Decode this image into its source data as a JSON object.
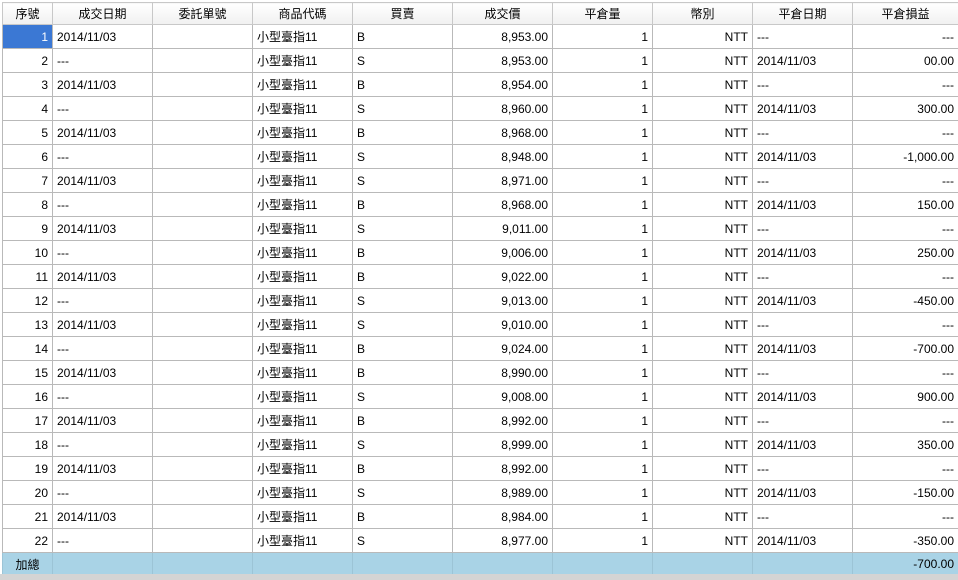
{
  "columns": [
    "序號",
    "成交日期",
    "委託單號",
    "商品代碼",
    "買賣",
    "成交價",
    "平倉量",
    "幣別",
    "平倉日期",
    "平倉損益"
  ],
  "rows": [
    {
      "seq": "1",
      "date": "2014/11/03",
      "order": "",
      "product": "小型臺指11",
      "side": "B",
      "price": "8,953.00",
      "qty": "1",
      "currency": "NTT",
      "close_date": "---",
      "pnl": "---"
    },
    {
      "seq": "2",
      "date": "---",
      "order": "",
      "product": "小型臺指11",
      "side": "S",
      "price": "8,953.00",
      "qty": "1",
      "currency": "NTT",
      "close_date": "2014/11/03",
      "pnl": "00.00"
    },
    {
      "seq": "3",
      "date": "2014/11/03",
      "order": "",
      "product": "小型臺指11",
      "side": "B",
      "price": "8,954.00",
      "qty": "1",
      "currency": "NTT",
      "close_date": "---",
      "pnl": "---"
    },
    {
      "seq": "4",
      "date": "---",
      "order": "",
      "product": "小型臺指11",
      "side": "S",
      "price": "8,960.00",
      "qty": "1",
      "currency": "NTT",
      "close_date": "2014/11/03",
      "pnl": "300.00"
    },
    {
      "seq": "5",
      "date": "2014/11/03",
      "order": "",
      "product": "小型臺指11",
      "side": "B",
      "price": "8,968.00",
      "qty": "1",
      "currency": "NTT",
      "close_date": "---",
      "pnl": "---"
    },
    {
      "seq": "6",
      "date": "---",
      "order": "",
      "product": "小型臺指11",
      "side": "S",
      "price": "8,948.00",
      "qty": "1",
      "currency": "NTT",
      "close_date": "2014/11/03",
      "pnl": "-1,000.00"
    },
    {
      "seq": "7",
      "date": "2014/11/03",
      "order": "",
      "product": "小型臺指11",
      "side": "S",
      "price": "8,971.00",
      "qty": "1",
      "currency": "NTT",
      "close_date": "---",
      "pnl": "---"
    },
    {
      "seq": "8",
      "date": "---",
      "order": "",
      "product": "小型臺指11",
      "side": "B",
      "price": "8,968.00",
      "qty": "1",
      "currency": "NTT",
      "close_date": "2014/11/03",
      "pnl": "150.00"
    },
    {
      "seq": "9",
      "date": "2014/11/03",
      "order": "",
      "product": "小型臺指11",
      "side": "S",
      "price": "9,011.00",
      "qty": "1",
      "currency": "NTT",
      "close_date": "---",
      "pnl": "---"
    },
    {
      "seq": "10",
      "date": "---",
      "order": "",
      "product": "小型臺指11",
      "side": "B",
      "price": "9,006.00",
      "qty": "1",
      "currency": "NTT",
      "close_date": "2014/11/03",
      "pnl": "250.00"
    },
    {
      "seq": "11",
      "date": "2014/11/03",
      "order": "",
      "product": "小型臺指11",
      "side": "B",
      "price": "9,022.00",
      "qty": "1",
      "currency": "NTT",
      "close_date": "---",
      "pnl": "---"
    },
    {
      "seq": "12",
      "date": "---",
      "order": "",
      "product": "小型臺指11",
      "side": "S",
      "price": "9,013.00",
      "qty": "1",
      "currency": "NTT",
      "close_date": "2014/11/03",
      "pnl": "-450.00"
    },
    {
      "seq": "13",
      "date": "2014/11/03",
      "order": "",
      "product": "小型臺指11",
      "side": "S",
      "price": "9,010.00",
      "qty": "1",
      "currency": "NTT",
      "close_date": "---",
      "pnl": "---"
    },
    {
      "seq": "14",
      "date": "---",
      "order": "",
      "product": "小型臺指11",
      "side": "B",
      "price": "9,024.00",
      "qty": "1",
      "currency": "NTT",
      "close_date": "2014/11/03",
      "pnl": "-700.00"
    },
    {
      "seq": "15",
      "date": "2014/11/03",
      "order": "",
      "product": "小型臺指11",
      "side": "B",
      "price": "8,990.00",
      "qty": "1",
      "currency": "NTT",
      "close_date": "---",
      "pnl": "---"
    },
    {
      "seq": "16",
      "date": "---",
      "order": "",
      "product": "小型臺指11",
      "side": "S",
      "price": "9,008.00",
      "qty": "1",
      "currency": "NTT",
      "close_date": "2014/11/03",
      "pnl": "900.00"
    },
    {
      "seq": "17",
      "date": "2014/11/03",
      "order": "",
      "product": "小型臺指11",
      "side": "B",
      "price": "8,992.00",
      "qty": "1",
      "currency": "NTT",
      "close_date": "---",
      "pnl": "---"
    },
    {
      "seq": "18",
      "date": "---",
      "order": "",
      "product": "小型臺指11",
      "side": "S",
      "price": "8,999.00",
      "qty": "1",
      "currency": "NTT",
      "close_date": "2014/11/03",
      "pnl": "350.00"
    },
    {
      "seq": "19",
      "date": "2014/11/03",
      "order": "",
      "product": "小型臺指11",
      "side": "B",
      "price": "8,992.00",
      "qty": "1",
      "currency": "NTT",
      "close_date": "---",
      "pnl": "---"
    },
    {
      "seq": "20",
      "date": "---",
      "order": "",
      "product": "小型臺指11",
      "side": "S",
      "price": "8,989.00",
      "qty": "1",
      "currency": "NTT",
      "close_date": "2014/11/03",
      "pnl": "-150.00"
    },
    {
      "seq": "21",
      "date": "2014/11/03",
      "order": "",
      "product": "小型臺指11",
      "side": "B",
      "price": "8,984.00",
      "qty": "1",
      "currency": "NTT",
      "close_date": "---",
      "pnl": "---"
    },
    {
      "seq": "22",
      "date": "---",
      "order": "",
      "product": "小型臺指11",
      "side": "S",
      "price": "8,977.00",
      "qty": "1",
      "currency": "NTT",
      "close_date": "2014/11/03",
      "pnl": "-350.00"
    }
  ],
  "footer": {
    "label": "加總",
    "total": "-700.00"
  },
  "selected_row": 0,
  "colors": {
    "selected": "#3b78d4",
    "footer": "#a9d3e6"
  }
}
